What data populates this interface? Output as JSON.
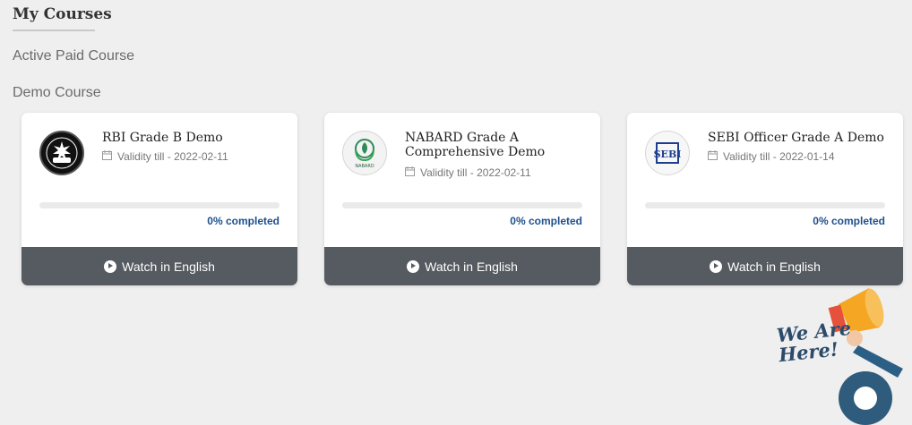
{
  "page": {
    "title": "My Courses",
    "sections": [
      "Active Paid Course",
      "Demo Course"
    ]
  },
  "courses": [
    {
      "name": "RBI Grade B Demo",
      "validity": "Validity till - 2022-02-11",
      "progress_percent": 0,
      "completed_text": "0% completed",
      "button_label": "Watch in English",
      "logo": "rbi-logo-icon"
    },
    {
      "name": "NABARD Grade A Comprehensive Demo",
      "validity": "Validity till - 2022-02-11",
      "progress_percent": 0,
      "completed_text": "0% completed",
      "button_label": "Watch in English",
      "logo": "nabard-logo-icon",
      "logo_text": "NABARD"
    },
    {
      "name": "SEBI Officer Grade A Demo",
      "validity": "Validity till - 2022-01-14",
      "progress_percent": 0,
      "completed_text": "0% completed",
      "button_label": "Watch in English",
      "logo": "sebi-logo-icon",
      "logo_text": "SEBI"
    }
  ],
  "promo": {
    "text_line1": "We Are",
    "text_line2": "Here!"
  },
  "colors": {
    "accent": "#1f4f8c",
    "button_bg": "#555b60",
    "page_bg": "#efefef"
  }
}
